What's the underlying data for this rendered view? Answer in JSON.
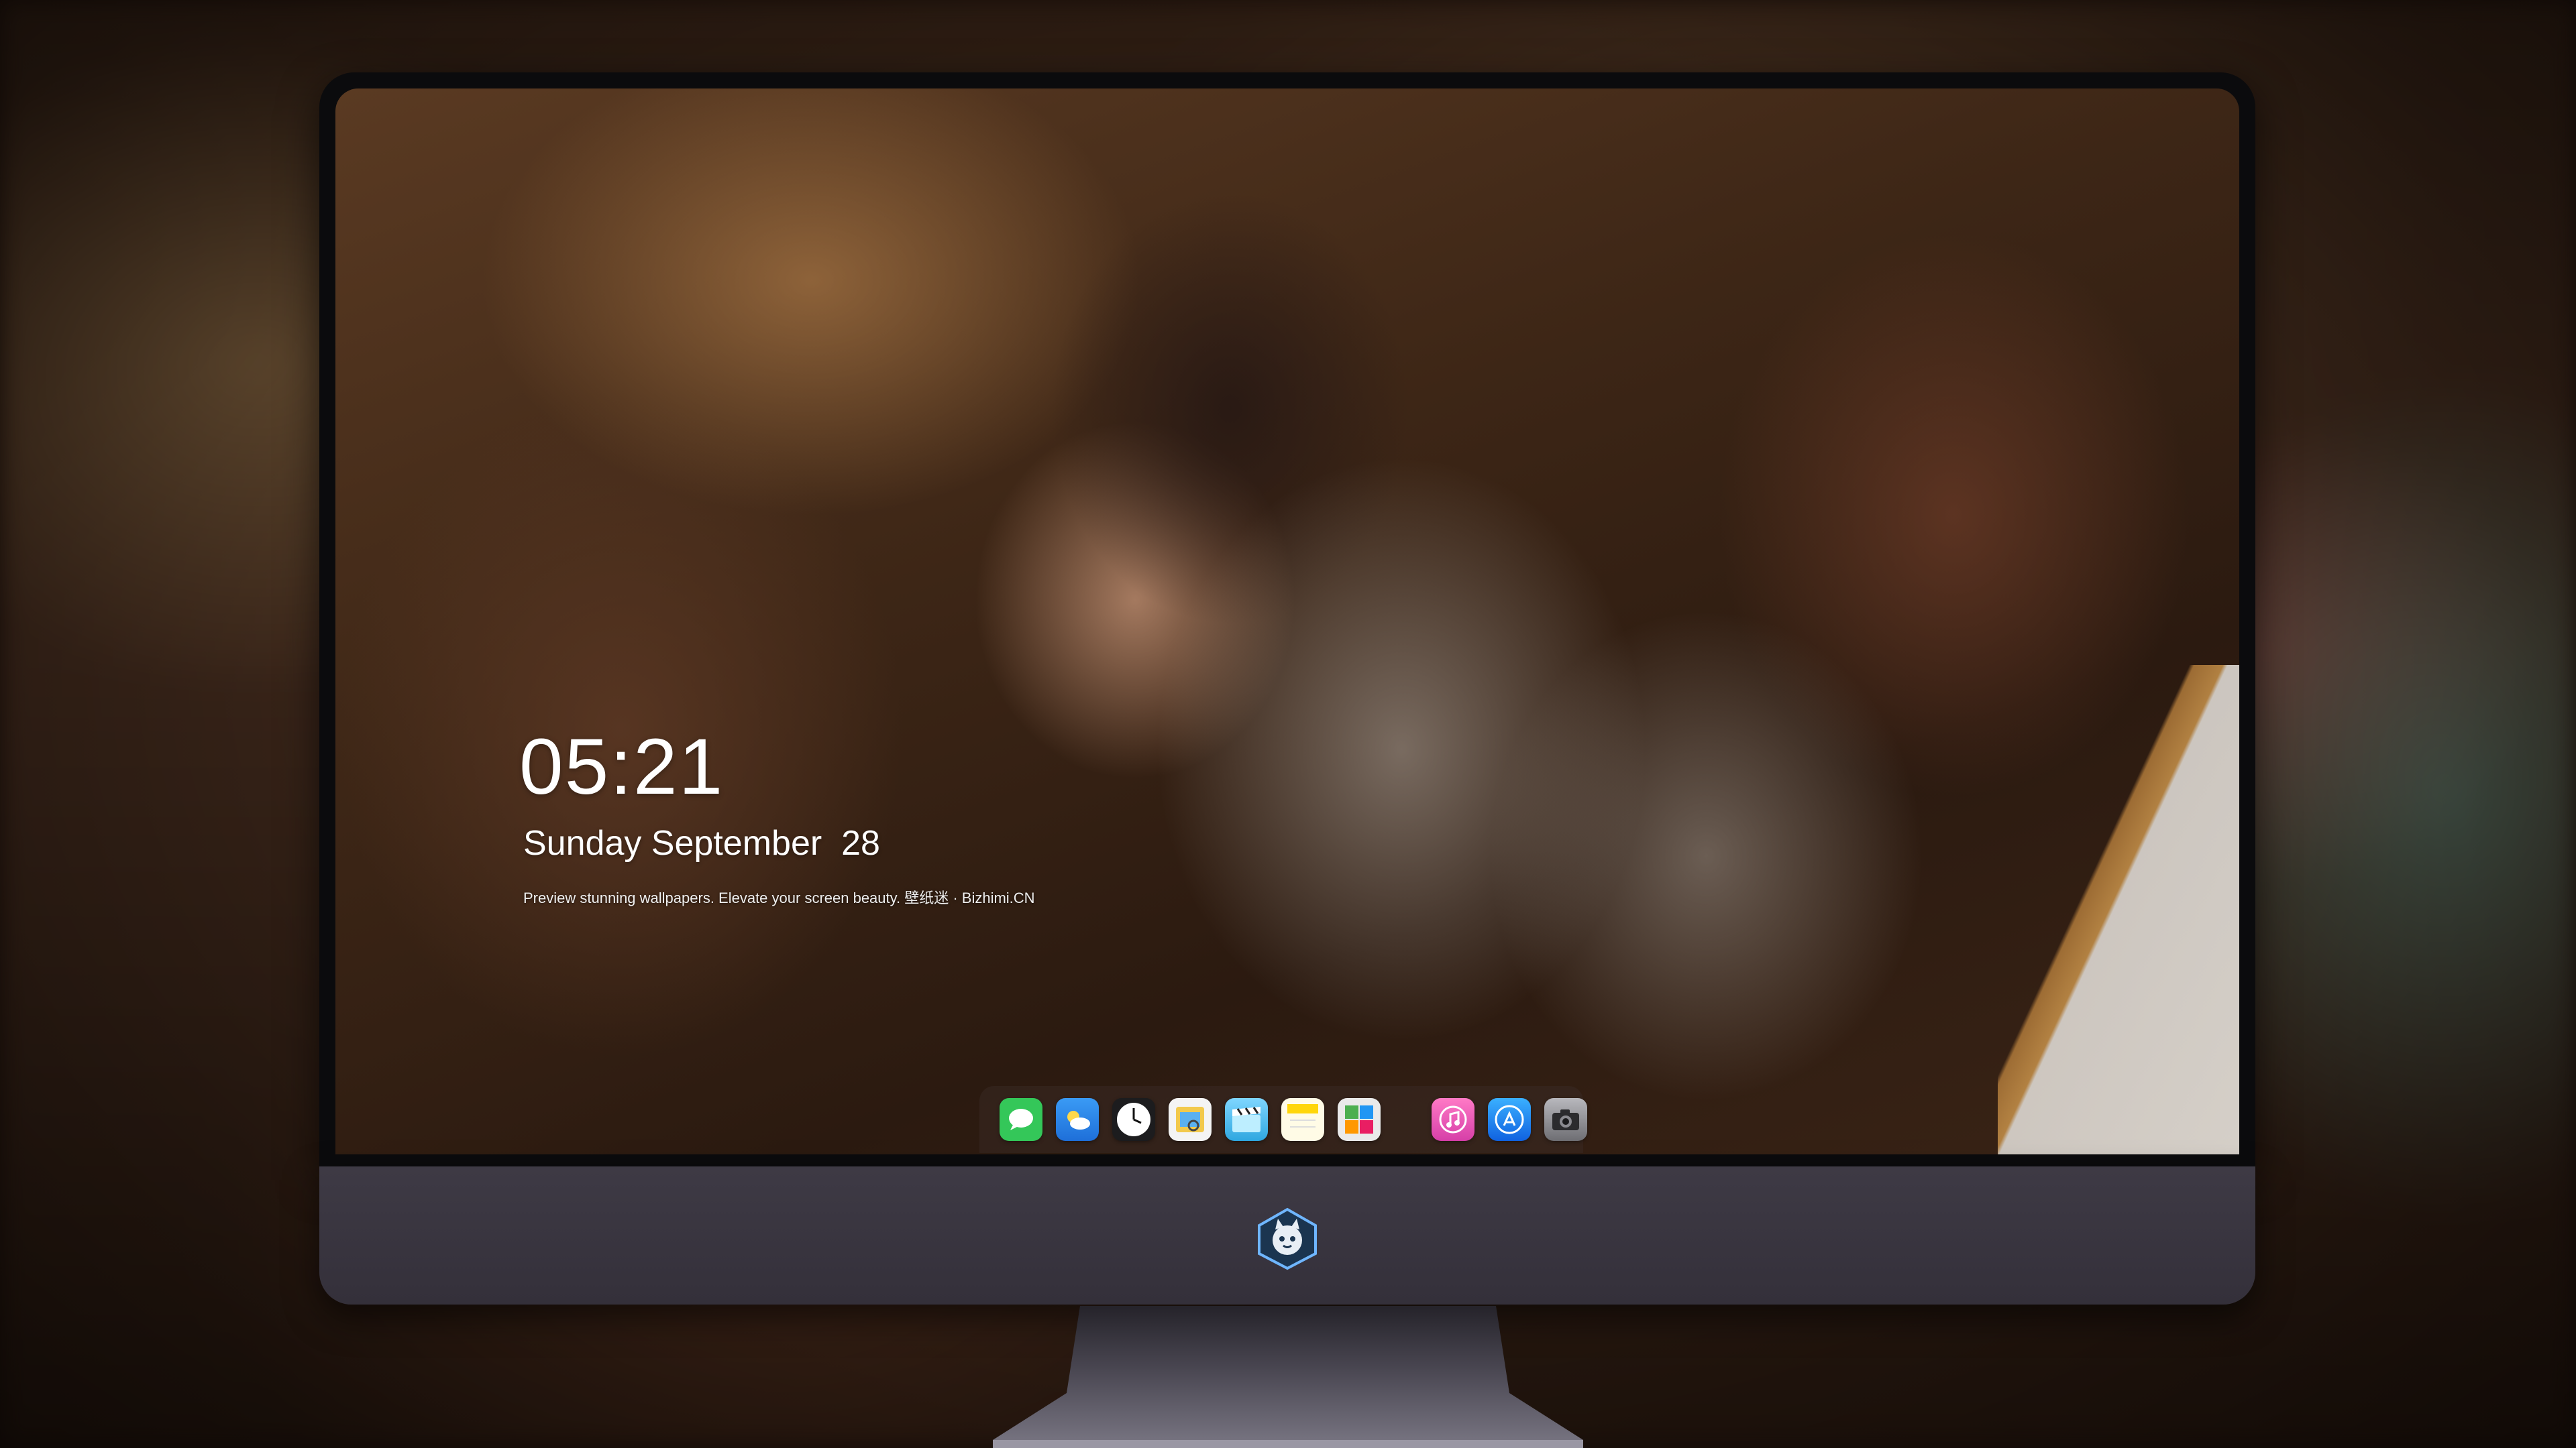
{
  "lockscreen": {
    "time": "05:21",
    "date": "Sunday September  28",
    "tagline": "Preview stunning wallpapers. Elevate your screen beauty. 壁纸迷 · Bizhimi.CN"
  },
  "dock": {
    "apps": [
      {
        "name": "messages-icon",
        "color": "#34c759"
      },
      {
        "name": "weather-icon",
        "color": "#2e8cf0"
      },
      {
        "name": "clock-icon",
        "color": "#ffffff"
      },
      {
        "name": "preview-icon",
        "color": "#f2c94c"
      },
      {
        "name": "video-icon",
        "color": "#5ac8fa"
      },
      {
        "name": "notes-icon",
        "color": "#ffd60a"
      },
      {
        "name": "photos-icon",
        "color": "#e9e9e9"
      },
      {
        "name": "music-icon",
        "color": "#ff5fb0"
      },
      {
        "name": "app-store-icon",
        "color": "#1f8fff"
      },
      {
        "name": "camera-icon",
        "color": "#8e8e93"
      }
    ]
  },
  "chin": {
    "logo_icon": "cat-logo-icon"
  }
}
